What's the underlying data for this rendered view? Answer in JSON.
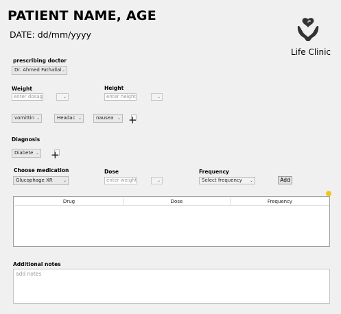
{
  "header": {
    "patient_title": "PATIENT NAME, AGE",
    "date": "DATE: dd/mm/yyyy",
    "clinic_name": "Life Clinic"
  },
  "doctor": {
    "label": "prescribing doctor",
    "selected": "Dr. Ahmed Fathallal"
  },
  "weight": {
    "label": "Weight",
    "placeholder": "enter dosage",
    "unit": ""
  },
  "height": {
    "label": "Height",
    "placeholder": "enter height",
    "unit": ""
  },
  "symptoms": {
    "items": [
      "vomittin",
      "Headac",
      "nausea"
    ],
    "add_icon": "plus-icon"
  },
  "diagnosis": {
    "label": "Diagnosis",
    "selected": "Diabete",
    "add_icon": "plus-icon"
  },
  "medication": {
    "label": "Choose medication",
    "selected": "Glucophage XR"
  },
  "dose": {
    "label": "Dose",
    "placeholder": "enter weight",
    "unit": ""
  },
  "frequency": {
    "label": "Frequency",
    "selected": "Select frequency"
  },
  "add_button": "Add",
  "table": {
    "columns": [
      "Drug",
      "Dose",
      "Frequency"
    ],
    "rows": []
  },
  "notes": {
    "label": "Additional notes",
    "placeholder": "add notes"
  },
  "colors": {
    "background": "#f0f0f0",
    "bulb": "#f2c61f"
  },
  "icons": {
    "logo": "hands-holding-heart-icon",
    "hint": "lightbulb-icon"
  }
}
